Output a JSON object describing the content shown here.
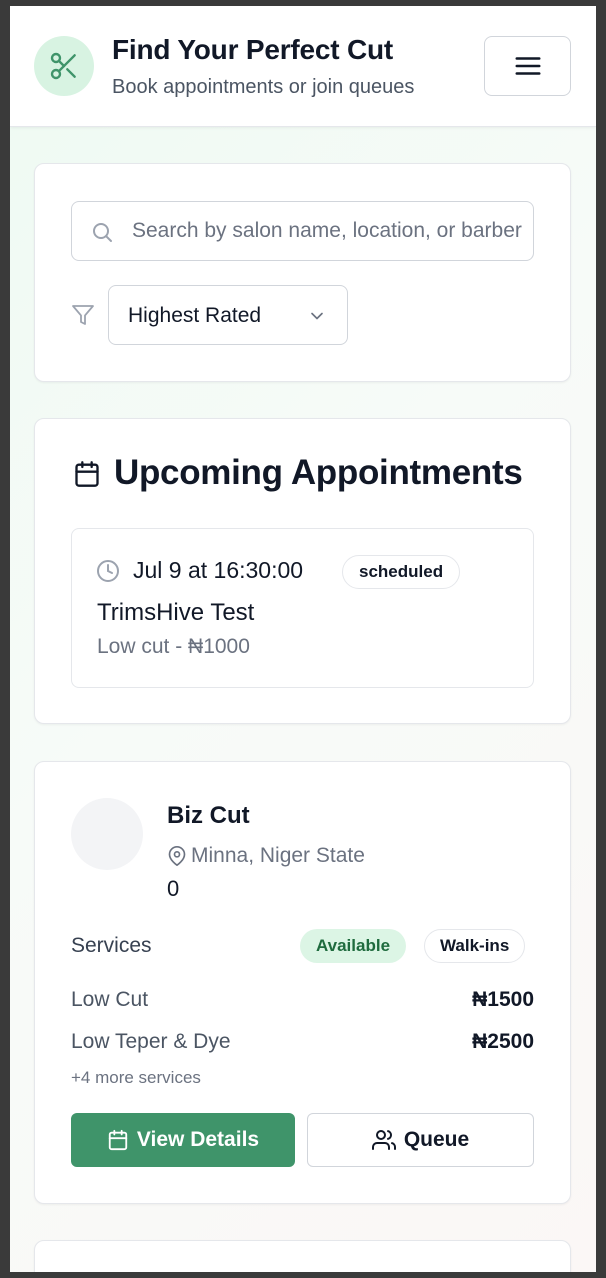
{
  "header": {
    "title": "Find Your Perfect Cut",
    "subtitle": "Book appointments or join queues",
    "logo_icon": "scissors-icon",
    "menu_icon": "hamburger-menu-icon"
  },
  "search": {
    "placeholder": "Search by salon name, location, or barber",
    "value": "",
    "sort_selected": "Highest Rated"
  },
  "appointments": {
    "heading": "Upcoming Appointments",
    "items": [
      {
        "time": "Jul 9 at 16:30:00",
        "status": "scheduled",
        "salon": "TrimsHive Test",
        "service": "Low cut - ₦1000"
      }
    ]
  },
  "salons": [
    {
      "name": "Biz Cut",
      "location": "Minna, Niger State",
      "rating": "0",
      "services_label": "Services",
      "badges": [
        "Available",
        "Walk-ins"
      ],
      "services": [
        {
          "name": "Low Cut",
          "price": "₦1500"
        },
        {
          "name": "Low Teper & Dye",
          "price": "₦2500"
        }
      ],
      "more_services": "+4 more services",
      "view_details_label": "View Details",
      "queue_label": "Queue"
    }
  ],
  "colors": {
    "accent": "#3f946a",
    "logo_bg": "#d8f3e2",
    "available_bg": "#dcf5e5"
  }
}
